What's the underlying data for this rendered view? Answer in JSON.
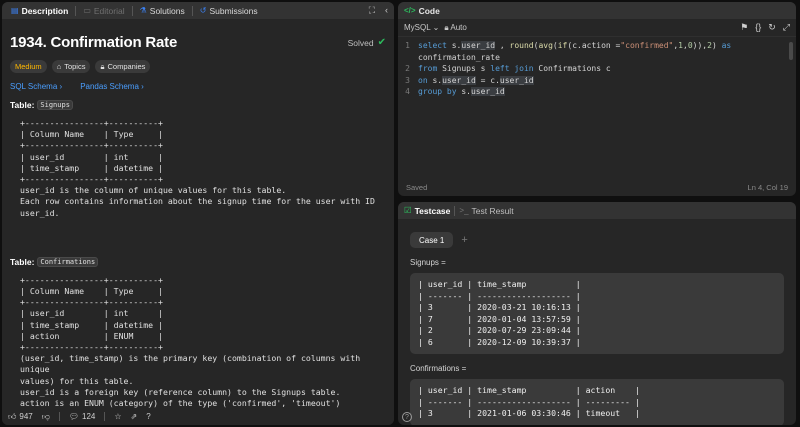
{
  "left": {
    "tabs": [
      {
        "label": "Description",
        "icon": "document-icon",
        "active": true
      },
      {
        "label": "Editorial",
        "icon": "book-icon",
        "dim": true
      },
      {
        "label": "Solutions",
        "icon": "flask-icon"
      },
      {
        "label": "Submissions",
        "icon": "history-icon"
      }
    ],
    "title": "1934. Confirmation Rate",
    "solved": "Solved",
    "badges": {
      "difficulty": "Medium",
      "topics": "Topics",
      "companies": "Companies"
    },
    "links": {
      "sql": "SQL Schema",
      "pandas": "Pandas Schema"
    },
    "table1": {
      "prefix": "Table:",
      "name": "Signups",
      "schema": "+----------------+----------+\n| Column Name    | Type     |\n+----------------+----------+\n| user_id        | int      |\n| time_stamp     | datetime |\n+----------------+----------+",
      "desc": "user_id is the column of unique values for this table.\nEach row contains information about the signup time for the user with ID\nuser_id."
    },
    "table2": {
      "prefix": "Table:",
      "name": "Confirmations",
      "schema": "+----------------+----------+\n| Column Name    | Type     |\n+----------------+----------+\n| user_id        | int      |\n| time_stamp     | datetime |\n| action         | ENUM     |\n+----------------+----------+",
      "desc": "(user_id, time_stamp) is the primary key (combination of columns with unique\nvalues) for this table.\nuser_id is a foreign key (reference column) to the Signups table.\naction is an ENUM (category) of the type ('confirmed', 'timeout')\nEach row of this table indicates that the user with ID user_id requested a"
    },
    "bottom": {
      "likes": "947",
      "comments": "124"
    }
  },
  "code": {
    "tab_label": "Code",
    "language": "MySQL",
    "mode": "Auto",
    "lines": [
      {
        "n": "1",
        "text": "select s.user_id , round(avg(if(c.action =\"confirmed\",1,0)),2) as"
      },
      {
        "n": "",
        "text": "confirmation_rate"
      },
      {
        "n": "2",
        "text": "from Signups s left join Confirmations c"
      },
      {
        "n": "3",
        "text": "on s.user_id = c.user_id"
      },
      {
        "n": "4",
        "text": "group by s.user_id"
      }
    ],
    "status_left": "Saved",
    "status_right": "Ln 4, Col 19"
  },
  "test": {
    "tab_testcase": "Testcase",
    "tab_result": "Test Result",
    "case_label": "Case 1",
    "signups_label": "Signups =",
    "signups_table": "| user_id | time_stamp          |\n| ------- | ------------------- |\n| 3       | 2020-03-21 10:16:13 |\n| 7       | 2020-01-04 13:57:59 |\n| 2       | 2020-07-29 23:09:44 |\n| 6       | 2020-12-09 10:39:37 |",
    "confirmations_label": "Confirmations =",
    "confirmations_table": "| user_id | time_stamp          | action    |\n| ------- | ------------------- | --------- |\n| 3       | 2021-01-06 03:30:46 | timeout   |"
  }
}
